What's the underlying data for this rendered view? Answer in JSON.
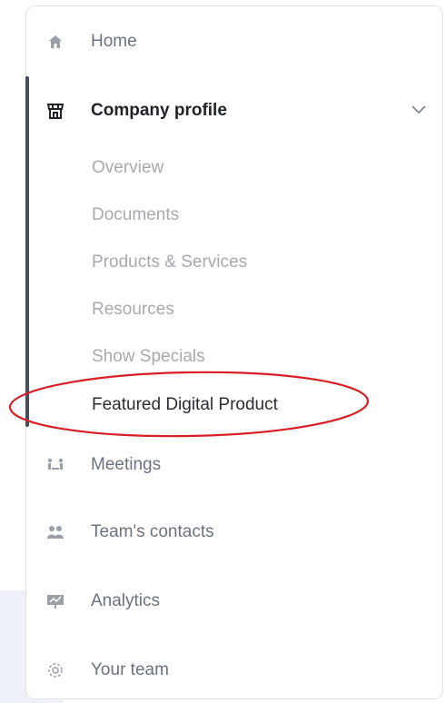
{
  "nav": {
    "home": "Home",
    "company_profile": "Company profile",
    "sub_items": [
      "Overview",
      "Documents",
      "Products & Services",
      "Resources",
      "Show Specials",
      "Featured Digital Product"
    ],
    "meetings": "Meetings",
    "teams_contacts": "Team's contacts",
    "analytics": "Analytics",
    "your_team": "Your team"
  },
  "icons": {
    "home": "home-icon",
    "company_profile": "storefront-icon",
    "meetings": "meeting-icon",
    "teams_contacts": "contacts-icon",
    "analytics": "analytics-icon",
    "your_team": "gear-icon",
    "expand": "chevron-down-icon"
  },
  "colors": {
    "active_indicator": "#4a4f57",
    "annotation_circle": "#d81f26"
  }
}
